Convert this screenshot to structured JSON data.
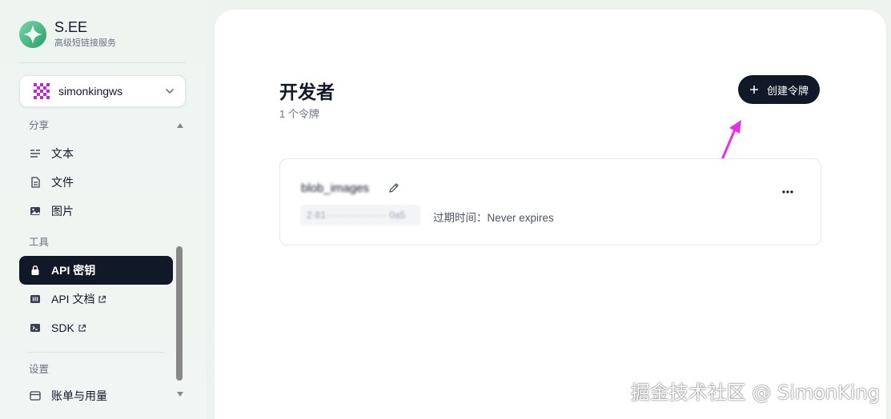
{
  "brand": {
    "title": "S.EE",
    "subtitle": "高级短链接服务"
  },
  "account": {
    "name": "simonkingws"
  },
  "sidebar": {
    "sections": [
      {
        "title": "分享",
        "items": [
          {
            "label": "文本",
            "icon": "text-icon"
          },
          {
            "label": "文件",
            "icon": "file-icon"
          },
          {
            "label": "图片",
            "icon": "image-icon"
          }
        ]
      },
      {
        "title": "工具",
        "items": [
          {
            "label": "API 密钥",
            "icon": "lock-icon",
            "active": true
          },
          {
            "label": "API 文档",
            "icon": "doc-icon",
            "external": true
          },
          {
            "label": "SDK",
            "icon": "terminal-icon",
            "external": true
          }
        ]
      },
      {
        "title": "设置",
        "items": [
          {
            "label": "账单与用量",
            "icon": "billing-icon"
          }
        ]
      }
    ]
  },
  "main": {
    "title": "开发者",
    "subtitle": "1 个令牌",
    "create_button": "创建令牌",
    "token": {
      "name": "blob_images",
      "key_masked": "2·81··················· 0a5",
      "expiry": "过期时间：Never expires"
    }
  },
  "watermark": "掘金技术社区 @ SimonKing",
  "colors": {
    "accent_dark": "#111827",
    "arrow": "#e62ee6",
    "logo_green": "#34d399"
  }
}
